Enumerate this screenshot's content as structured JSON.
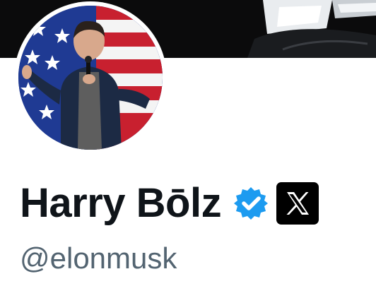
{
  "profile": {
    "display_name": "Harry Bōlz",
    "handle": "@elonmusk",
    "verified": true,
    "affiliate_badge": "x-logo-icon"
  },
  "icons": {
    "verified": "verified-badge-icon",
    "affiliate": "x-logo-icon",
    "avatar": "profile-photo"
  },
  "colors": {
    "name_text": "#0f1419",
    "handle_text": "#536471",
    "verified_blue": "#1d9bf0",
    "banner": "#0b0b0c",
    "badge_bg": "#000000"
  }
}
